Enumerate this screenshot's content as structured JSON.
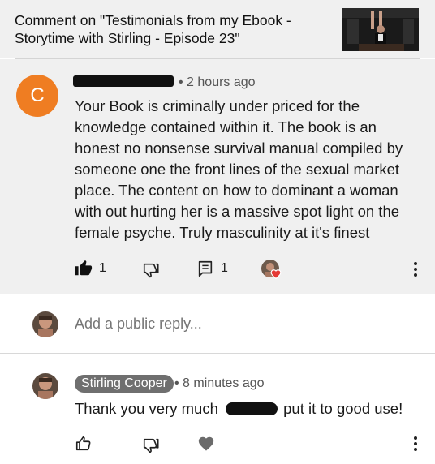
{
  "header": {
    "title_line1": "Comment on \"Testimonials from my Ebook -",
    "title_line2": "Storytime with Stirling - Episode 23\""
  },
  "comment": {
    "avatar_letter": "C",
    "timestamp": "2 hours ago",
    "body": "Your Book is criminally under priced for the knowledge contained within it. The book is an honest no nonsense survival manual compiled by someone one the front lines of the sexual market place. The content on how to dominant a woman with out hurting her is a massive spot light on the female psyche. Truly masculinity at it's finest",
    "like_count": "1",
    "reply_count": "1",
    "icons": {
      "like": "thumbs-up-filled-icon",
      "dislike": "thumbs-down-icon",
      "reply": "reply-comment-icon",
      "creator_heart": "creator-heart-icon",
      "more": "more-vert-icon"
    },
    "colors": {
      "avatar": "#ef7d22",
      "heart": "#e53935",
      "background": "#f0f0f0"
    }
  },
  "reply_input": {
    "placeholder": "Add a public reply..."
  },
  "reply": {
    "author": "Stirling Cooper",
    "timestamp": "8 minutes ago",
    "body_before": "Thank you very much",
    "body_after": "put it to good use!",
    "icons": {
      "like": "thumbs-up-outline-icon",
      "dislike": "thumbs-down-icon",
      "heart": "heart-icon",
      "more": "more-vert-icon"
    }
  }
}
